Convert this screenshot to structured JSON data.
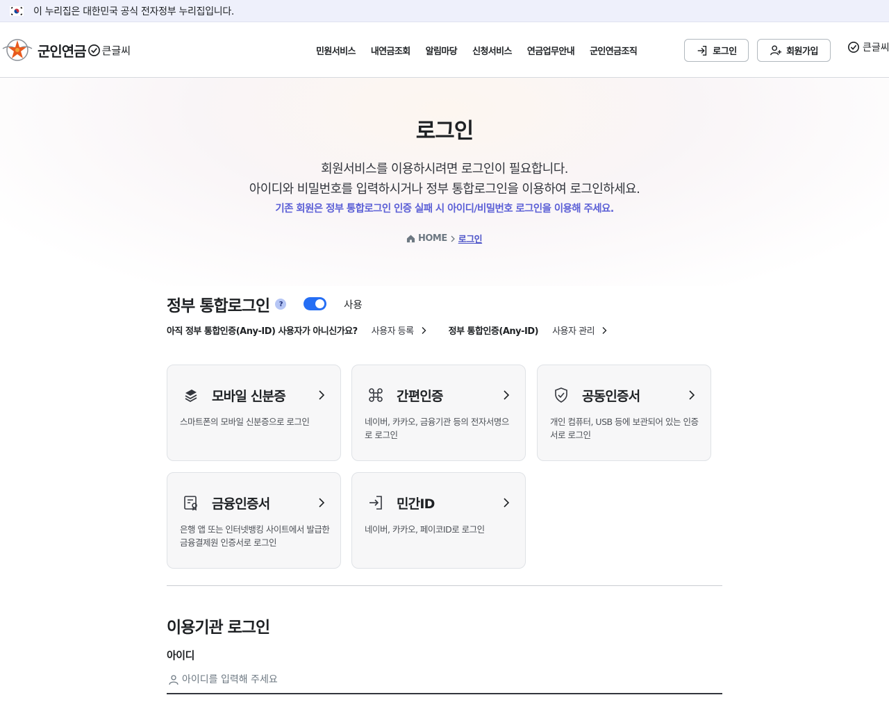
{
  "gov_banner": {
    "text": "이 누리집은 대한민국 공식 전자정부 누리집입니다."
  },
  "header": {
    "logo_title": "군인연금",
    "logo_bigtext": "큰글씨",
    "nav": [
      "민원서비스",
      "내연금조회",
      "알림마당",
      "신청서비스",
      "연금업무안내",
      "군인연금조직"
    ],
    "login_button": "로그인",
    "signup_button": "회원가입",
    "bigtext_link": "큰글씨"
  },
  "hero": {
    "title": "로그인",
    "desc1": "회원서비스를 이용하시려면 로그인이 필요합니다.",
    "desc2": "아이디와 비밀번호를 입력하시거나 정부 통합로그인을 이용하여 로그인하세요.",
    "notice": "기존 회원은 정부 통합로그인 인증 실패 시 아이디/비밀번호 로그인을 이용해 주세요.",
    "breadcrumb_home": "HOME",
    "breadcrumb_current": "로그인"
  },
  "gov_login": {
    "title": "정부 통합로그인",
    "help": "?",
    "toggle_label": "사용",
    "toggle_on": true,
    "question": "아직 정부 통합인증(Any-ID) 사용자가 아니신가요?",
    "register_link": "사용자 등록",
    "anyid_label": "정부 통합인증(Any-ID)",
    "manage_link": "사용자 관리"
  },
  "cards": [
    {
      "icon": "mobile-id-icon",
      "title": "모바일 신분증",
      "desc": "스마트폰의 모바일 신분증으로 로그인"
    },
    {
      "icon": "simple-auth-icon",
      "title": "간편인증",
      "desc": "네이버, 카카오, 금융기관 등의 전자서명으로 로그인"
    },
    {
      "icon": "shield-check-icon",
      "title": "공동인증서",
      "desc": "개인 컴퓨터, USB 등에 보관되어 있는 인증서로 로그인"
    },
    {
      "icon": "certificate-doc-icon",
      "title": "금융인증서",
      "desc": "은행 앱 또는 인터넷뱅킹 사이트에서 발급한 금융결제원 인증서로 로그인"
    },
    {
      "icon": "sign-in-icon",
      "title": "민간ID",
      "desc": "네이버, 카카오, 페이코ID로 로그인"
    }
  ],
  "institution_login": {
    "title": "이용기관 로그인",
    "id_label": "아이디",
    "id_placeholder": "아이디를 입력해 주세요",
    "id_value": ""
  },
  "colors": {
    "accent": "#256ef4",
    "notice": "#5b5fd6",
    "breadcrumb_current": "#4e55c9"
  }
}
